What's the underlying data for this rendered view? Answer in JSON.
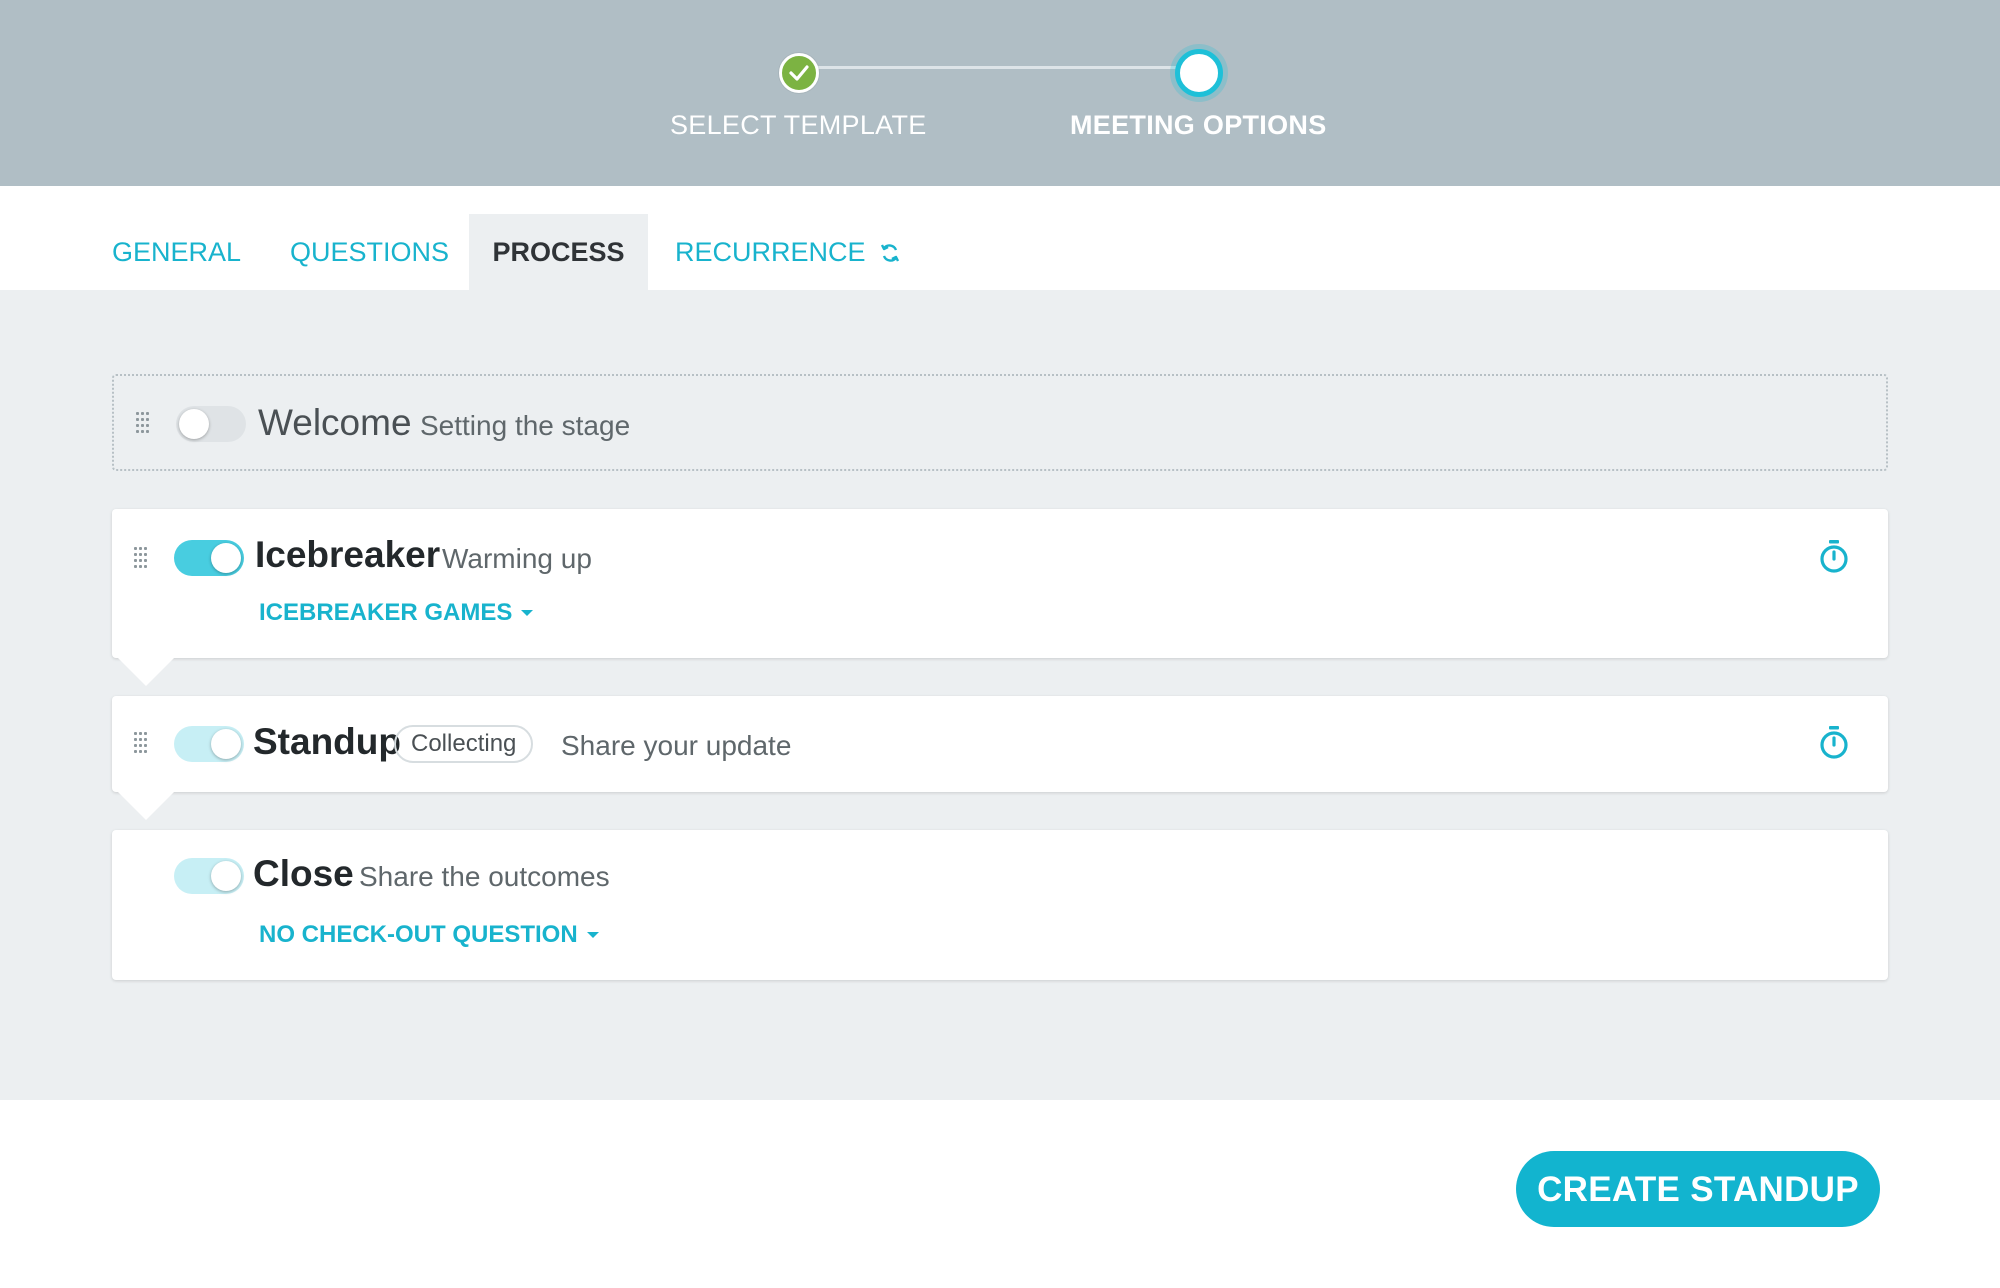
{
  "stepper": {
    "steps": [
      {
        "label": "SELECT TEMPLATE",
        "status": "complete"
      },
      {
        "label": "MEETING OPTIONS",
        "status": "current"
      }
    ]
  },
  "tabs": [
    {
      "label": "GENERAL",
      "active": false
    },
    {
      "label": "QUESTIONS",
      "active": false
    },
    {
      "label": "PROCESS",
      "active": true
    },
    {
      "label": "RECURRENCE",
      "active": false,
      "icon": "refresh-icon"
    }
  ],
  "stages": {
    "welcome": {
      "title": "Welcome",
      "subtitle": "Setting the stage",
      "enabled": false
    },
    "icebreaker": {
      "title": "Icebreaker",
      "subtitle": "Warming up",
      "enabled": true,
      "dropdown": "ICEBREAKER GAMES",
      "icon": "timer-icon"
    },
    "standup": {
      "title": "Standup",
      "badge": "Collecting",
      "subtitle": "Share your update",
      "enabled": true,
      "icon": "timer-icon"
    },
    "close": {
      "title": "Close",
      "subtitle": "Share the outcomes",
      "enabled": true,
      "dropdown": "NO CHECK-OUT QUESTION"
    }
  },
  "footer": {
    "create_label": "CREATE STANDUP"
  },
  "colors": {
    "accent": "#18b3cd",
    "header_bg": "#b0bec5",
    "complete": "#7cb342",
    "content_bg": "#eceff1"
  }
}
